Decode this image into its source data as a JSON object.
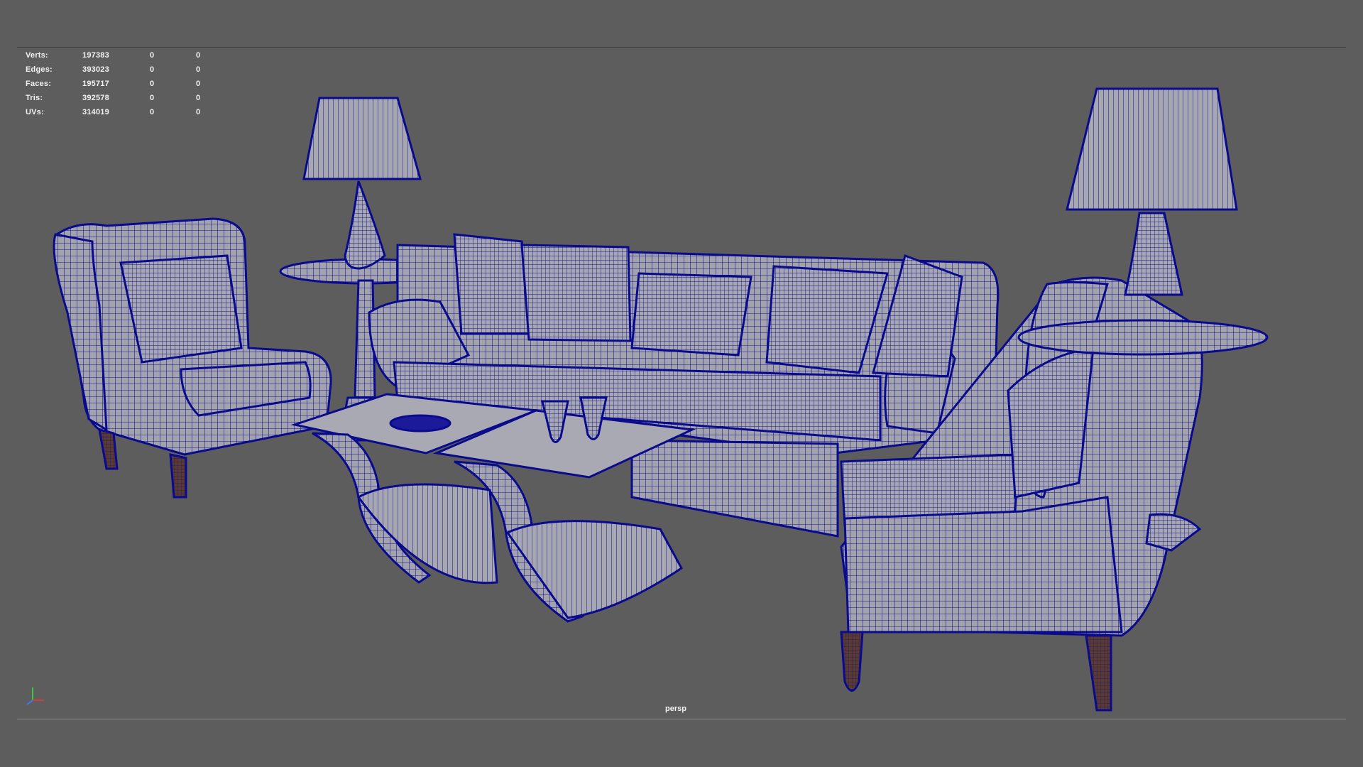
{
  "hud": {
    "rows": [
      {
        "label": "Verts:",
        "value": "197383",
        "c2": "0",
        "c3": "0"
      },
      {
        "label": "Edges:",
        "value": "393023",
        "c2": "0",
        "c3": "0"
      },
      {
        "label": "Faces:",
        "value": "195717",
        "c2": "0",
        "c3": "0"
      },
      {
        "label": "Tris:",
        "value": "392578",
        "c2": "0",
        "c3": "0"
      },
      {
        "label": "UVs:",
        "value": "314019",
        "c2": "0",
        "c3": "0"
      }
    ]
  },
  "viewport": {
    "camera_label": "persp",
    "background_color": "#5d5d5d",
    "wire_color": "#0a0a8c",
    "surface_color": "#9a9aa6"
  },
  "gizmo": {
    "icon": "axis-gizmo-icon",
    "x_color": "#d23c3c",
    "y_color": "#3cc83c",
    "z_color": "#3c78ff"
  }
}
